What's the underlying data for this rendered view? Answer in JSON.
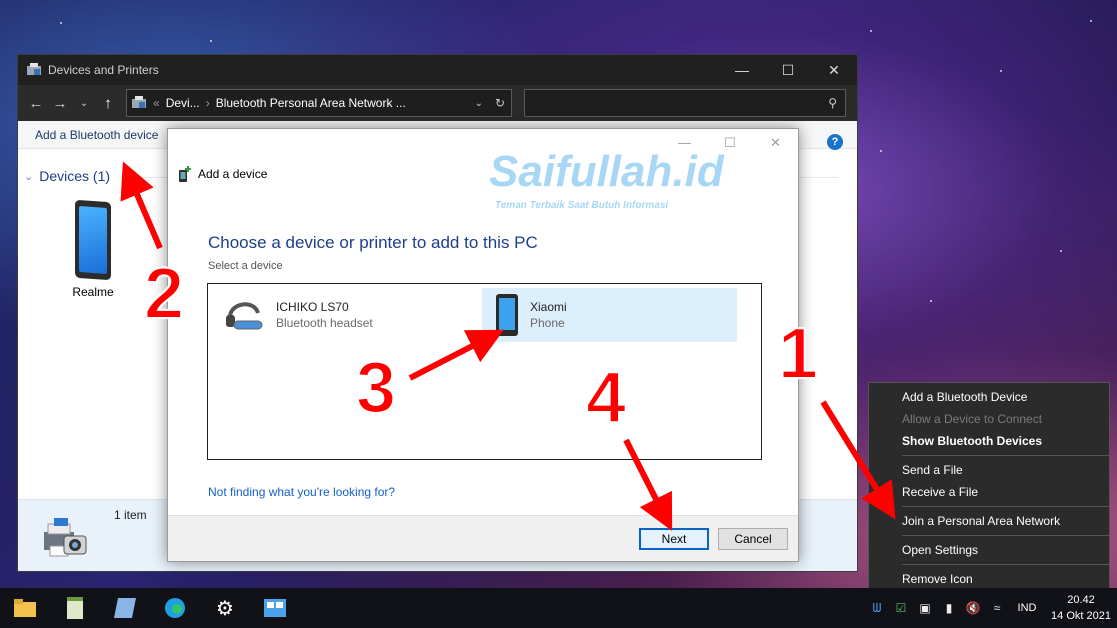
{
  "explorer": {
    "title": "Devices and Printers",
    "address_short": "Devi...",
    "address_current": "Bluetooth Personal Area Network ...",
    "command_add": "Add a Bluetooth device",
    "help": "?",
    "group_label": "Devices (1)",
    "device_label": "Realme",
    "item_count": "1 item"
  },
  "dialog": {
    "title": "Add a device",
    "heading": "Choose a device or printer to add to this PC",
    "subheading": "Select a device",
    "devices": [
      {
        "name": "ICHIKO LS70",
        "type": "Bluetooth headset",
        "icon": "headset-icon",
        "selected": false
      },
      {
        "name": "Xiaomi",
        "type": "Phone",
        "icon": "phone-icon",
        "selected": true
      }
    ],
    "help_link": "Not finding what you're looking for?",
    "next_label": "Next",
    "cancel_label": "Cancel"
  },
  "watermark": {
    "brand": "Saifullah.id",
    "tagline": "Teman Terbaik Saat Butuh Informasi"
  },
  "context_menu": {
    "items": [
      {
        "label": "Add a Bluetooth Device",
        "state": "normal"
      },
      {
        "label": "Allow a Device to Connect",
        "state": "disabled"
      },
      {
        "label": "Show Bluetooth Devices",
        "state": "bold"
      },
      {
        "label": "Send a File",
        "state": "normal"
      },
      {
        "label": "Receive a File",
        "state": "normal"
      },
      {
        "label": "Join a Personal Area Network",
        "state": "normal"
      },
      {
        "label": "Open Settings",
        "state": "normal"
      },
      {
        "label": "Remove Icon",
        "state": "normal"
      }
    ]
  },
  "annotations": [
    "1",
    "2",
    "3",
    "4"
  ],
  "taskbar": {
    "language": "IND",
    "time": "20.42",
    "date": "14 Okt 2021"
  },
  "colors": {
    "annotation_red": "#ff0000",
    "selection_blue": "#dbeefb",
    "link_blue": "#1560c8",
    "heading_blue": "#1e3e8a"
  }
}
